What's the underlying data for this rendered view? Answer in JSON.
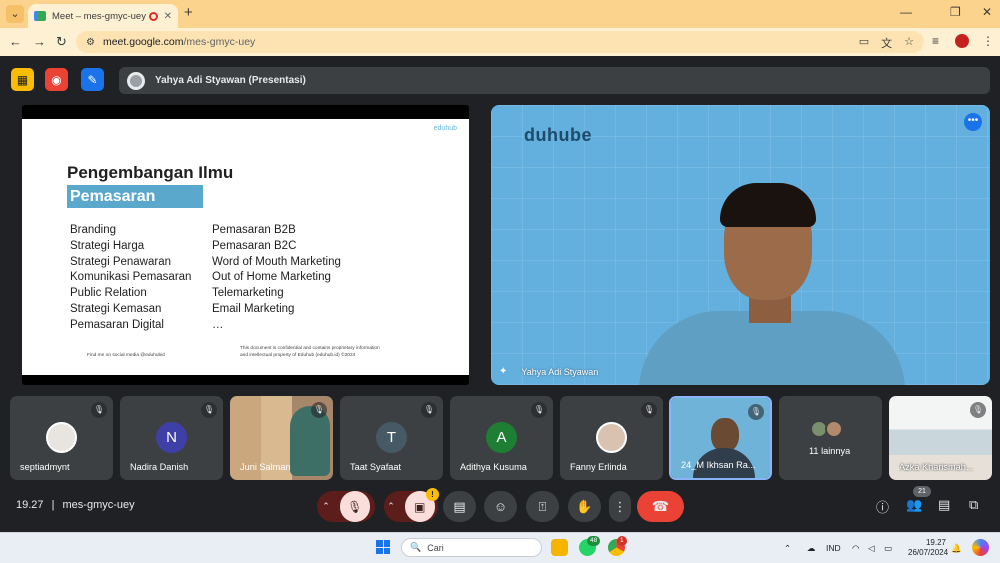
{
  "browser": {
    "tab_title": "Meet – mes-gmyc-uey",
    "url_host": "meet.google.com",
    "url_path": "/mes-gmyc-uey",
    "menu_glyph": "⌄",
    "close_glyph": "✕",
    "new_tab_glyph": "+",
    "back_glyph": "←",
    "forward_glyph": "→",
    "reload_glyph": "↻",
    "minimize_glyph": "—",
    "maximize_glyph": "❐",
    "window_close_glyph": "✕",
    "more_glyph": "⋮"
  },
  "meet": {
    "presenter_label": "Yahya Adi Styawan (Presentasi)",
    "time": "19.27",
    "separator": "|",
    "meeting_code": "mes-gmyc-uey",
    "warning_badge": "!",
    "people_count": "21"
  },
  "slide": {
    "logo": "eduhub",
    "title": "Pengembangan Ilmu",
    "subtitle": "Pemasaran",
    "left_items": [
      "Branding",
      "Strategi Harga",
      "Strategi Penawaran",
      "Komunikasi Pemasaran",
      "Public Relation",
      "Strategi Kemasan",
      "Pemasaran Digital"
    ],
    "right_items": [
      "Pemasaran B2B",
      "Pemasaran B2C",
      "Word of Mouth Marketing",
      "Out of Home Marketing",
      "Telemarketing",
      "Email Marketing",
      "…"
    ],
    "footer_left": "Find me on social media @eduhubid",
    "footer_right_line1": "This document is confidential and contains proprietary information",
    "footer_right_line2": "and intellectual property of Eduhub (eduhub.id) ©2024"
  },
  "main_video": {
    "brand_text": "duhube",
    "name": "Yahya Adi Styawan",
    "more_glyph": "•••"
  },
  "participants": [
    {
      "name": "septiadmynt",
      "initial": "",
      "avatar_color": "#e8e4df"
    },
    {
      "name": "Nadira Danish",
      "initial": "N",
      "avatar_color": "#3f3fa8"
    },
    {
      "name": "Juni Salman",
      "initial": "",
      "avatar_color": "#b58a5a"
    },
    {
      "name": "Taat Syafaat",
      "initial": "T",
      "avatar_color": "#455a64"
    },
    {
      "name": "Adithya Kusuma",
      "initial": "A",
      "avatar_color": "#1e7e34"
    },
    {
      "name": "Fanny Erlinda",
      "initial": "",
      "avatar_color": "#d9c2b0"
    },
    {
      "name": "24_M Ikhsan Ra...",
      "initial": "",
      "avatar_color": "#6fb3d8"
    },
    {
      "name": "11 lainnya",
      "initial": "",
      "avatar_color": "#3c4043"
    },
    {
      "name": "Azka Kharismah...",
      "initial": "",
      "avatar_color": "#dfe3e6"
    }
  ],
  "taskbar": {
    "search_placeholder": "Cari",
    "whatsapp_badge": "48",
    "chrome_badge": "1",
    "language": "IND",
    "time": "19.27",
    "date": "26/07/2024"
  },
  "colors": {
    "meet_bg": "#202124",
    "tile_bg": "#3c4043",
    "end_call": "#ea4335",
    "mic_off_bg": "#f9dedc",
    "chrome_tab_strip": "#fbd38d",
    "presentation_blue": "#5ba8cd"
  }
}
